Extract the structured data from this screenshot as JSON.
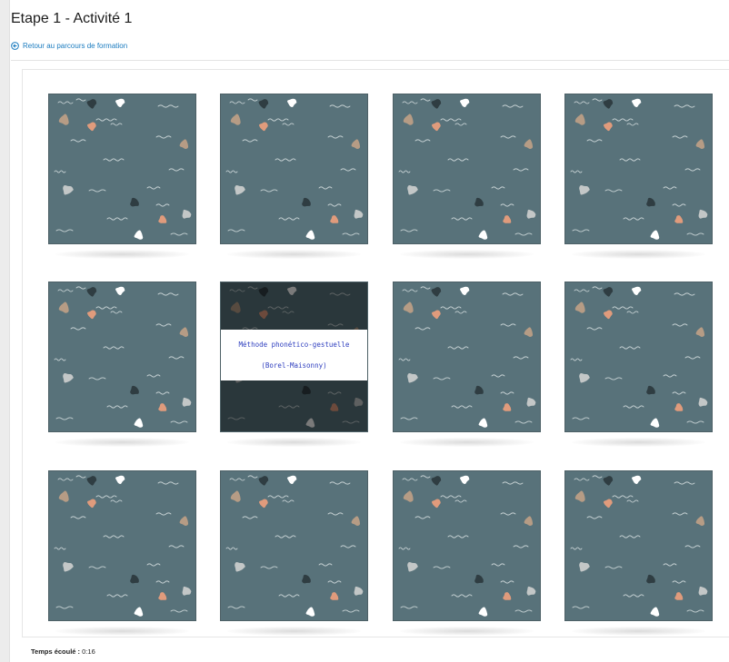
{
  "page": {
    "title": "Etape 1 - Activité 1",
    "back_link": "Retour au parcours de formation"
  },
  "game": {
    "card_back_colors": {
      "background": "#58727a",
      "squiggle": "#c7d2d4",
      "blob_tan": "#b69c85",
      "blob_charcoal": "#2f3d42",
      "blob_white": "#ffffff",
      "blob_peach": "#e09b7c",
      "blob_gray": "#c3c7c7"
    },
    "cards": [
      {
        "state": "face-down"
      },
      {
        "state": "face-down"
      },
      {
        "state": "face-down"
      },
      {
        "state": "face-down"
      },
      {
        "state": "face-down"
      },
      {
        "state": "revealed",
        "line1": "Méthode phonético-gestuelle",
        "line2": "(Borel-Maisonny)"
      },
      {
        "state": "face-down"
      },
      {
        "state": "face-down"
      },
      {
        "state": "face-down"
      },
      {
        "state": "face-down"
      },
      {
        "state": "face-down"
      },
      {
        "state": "face-down"
      }
    ]
  },
  "timer": {
    "label": "Temps écoulé :",
    "value": "0:16"
  }
}
